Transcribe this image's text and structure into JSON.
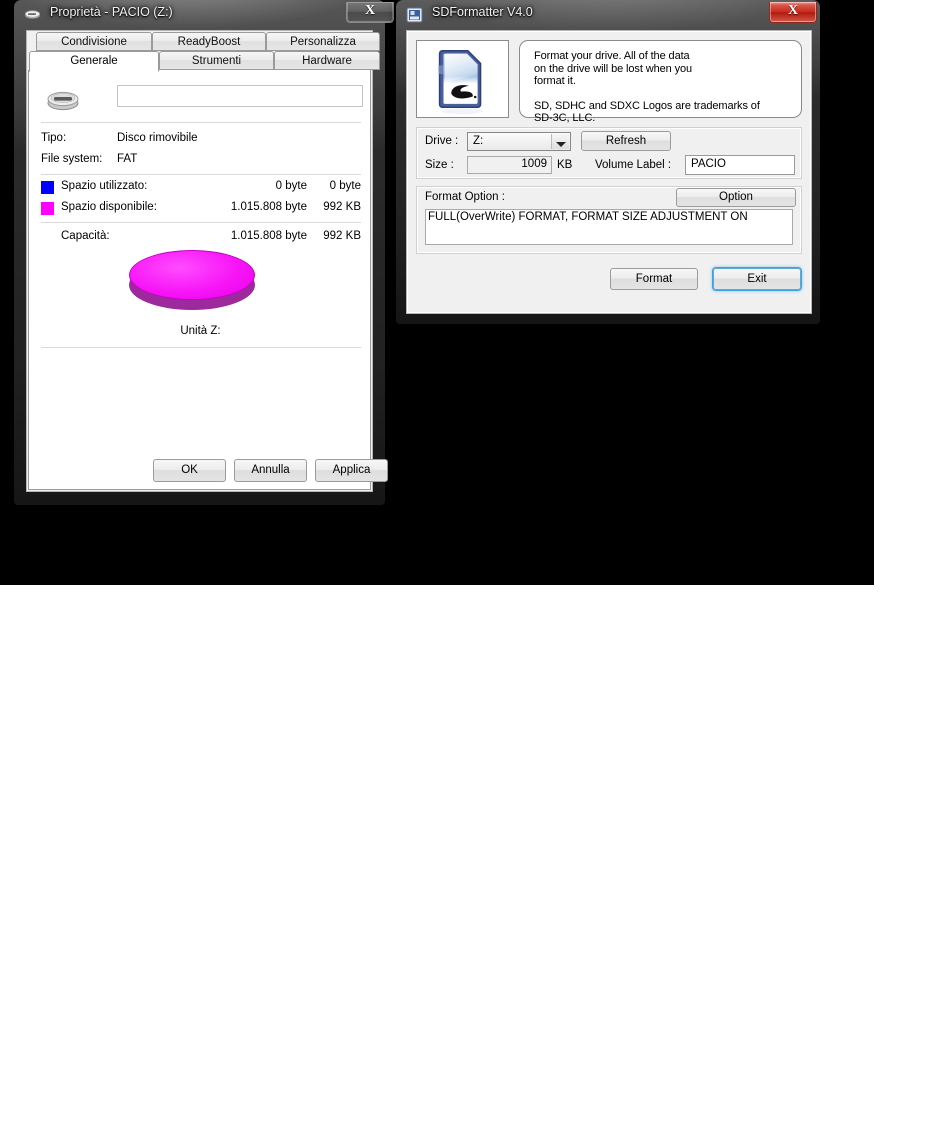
{
  "desktop": {
    "background_color": "#000000"
  },
  "properties_window": {
    "title": "Proprietà - PACIO (Z:)",
    "icon": "removable-drive-icon",
    "close_label": "X",
    "tabs_row1": [
      {
        "label": "Condivisione",
        "active": false
      },
      {
        "label": "ReadyBoost",
        "active": false
      },
      {
        "label": "Personalizza",
        "active": false
      }
    ],
    "tabs_row2": [
      {
        "label": "Generale",
        "active": true
      },
      {
        "label": "Strumenti",
        "active": false
      },
      {
        "label": "Hardware",
        "active": false
      }
    ],
    "volume_name_value": "",
    "fields": [
      {
        "label": "Tipo:",
        "value": "Disco rimovibile"
      },
      {
        "label": "File system:",
        "value": "FAT"
      }
    ],
    "usage": [
      {
        "color": "#0000ff",
        "label": "Spazio utilizzato:",
        "bytes": "0 byte",
        "readable": "0 byte"
      },
      {
        "color": "#ff00ff",
        "label": "Spazio disponibile:",
        "bytes": "1.015.808 byte",
        "readable": "992 KB"
      }
    ],
    "capacity": {
      "label": "Capacità:",
      "bytes": "1.015.808 byte",
      "readable": "992 KB"
    },
    "chart_caption": "Unità Z:",
    "buttons": [
      {
        "label": "OK"
      },
      {
        "label": "Annulla"
      },
      {
        "label": "Applica"
      }
    ],
    "chart_data": {
      "type": "pie",
      "title": "Unità Z:",
      "categories": [
        "Spazio utilizzato",
        "Spazio disponibile"
      ],
      "values": [
        0,
        1015808
      ],
      "value_labels": [
        "0 byte",
        "1.015.808 byte"
      ],
      "percentages": [
        0,
        100
      ],
      "colors": [
        "#0000ff",
        "#ff00ff"
      ],
      "legend": "left",
      "unit": "byte",
      "total": 1015808,
      "total_readable": "992 KB"
    }
  },
  "sdformatter_window": {
    "title": "SDFormatter V4.0",
    "icon": "sdformatter-app-icon",
    "close_label": "X",
    "card_icon": "sd-card-icon",
    "message_lines": [
      "Format your drive. All of the data",
      "on the drive will be lost when you",
      "format it."
    ],
    "trademark_lines": [
      "SD, SDHC and SDXC Logos are trademarks of",
      "SD-3C, LLC."
    ],
    "drive_label": "Drive :",
    "drive_value": "Z:",
    "refresh_label": "Refresh",
    "size_label": "Size  :",
    "size_value": "1009",
    "size_unit": "KB",
    "volume_label_label": "Volume Label  :",
    "volume_label_value": "PACIO",
    "format_option_label": "Format Option :",
    "option_button_label": "Option",
    "format_option_value": "FULL(OverWrite) FORMAT, FORMAT SIZE ADJUSTMENT ON",
    "format_button_label": "Format",
    "exit_button_label": "Exit",
    "accent_color": "#3da2e0"
  }
}
